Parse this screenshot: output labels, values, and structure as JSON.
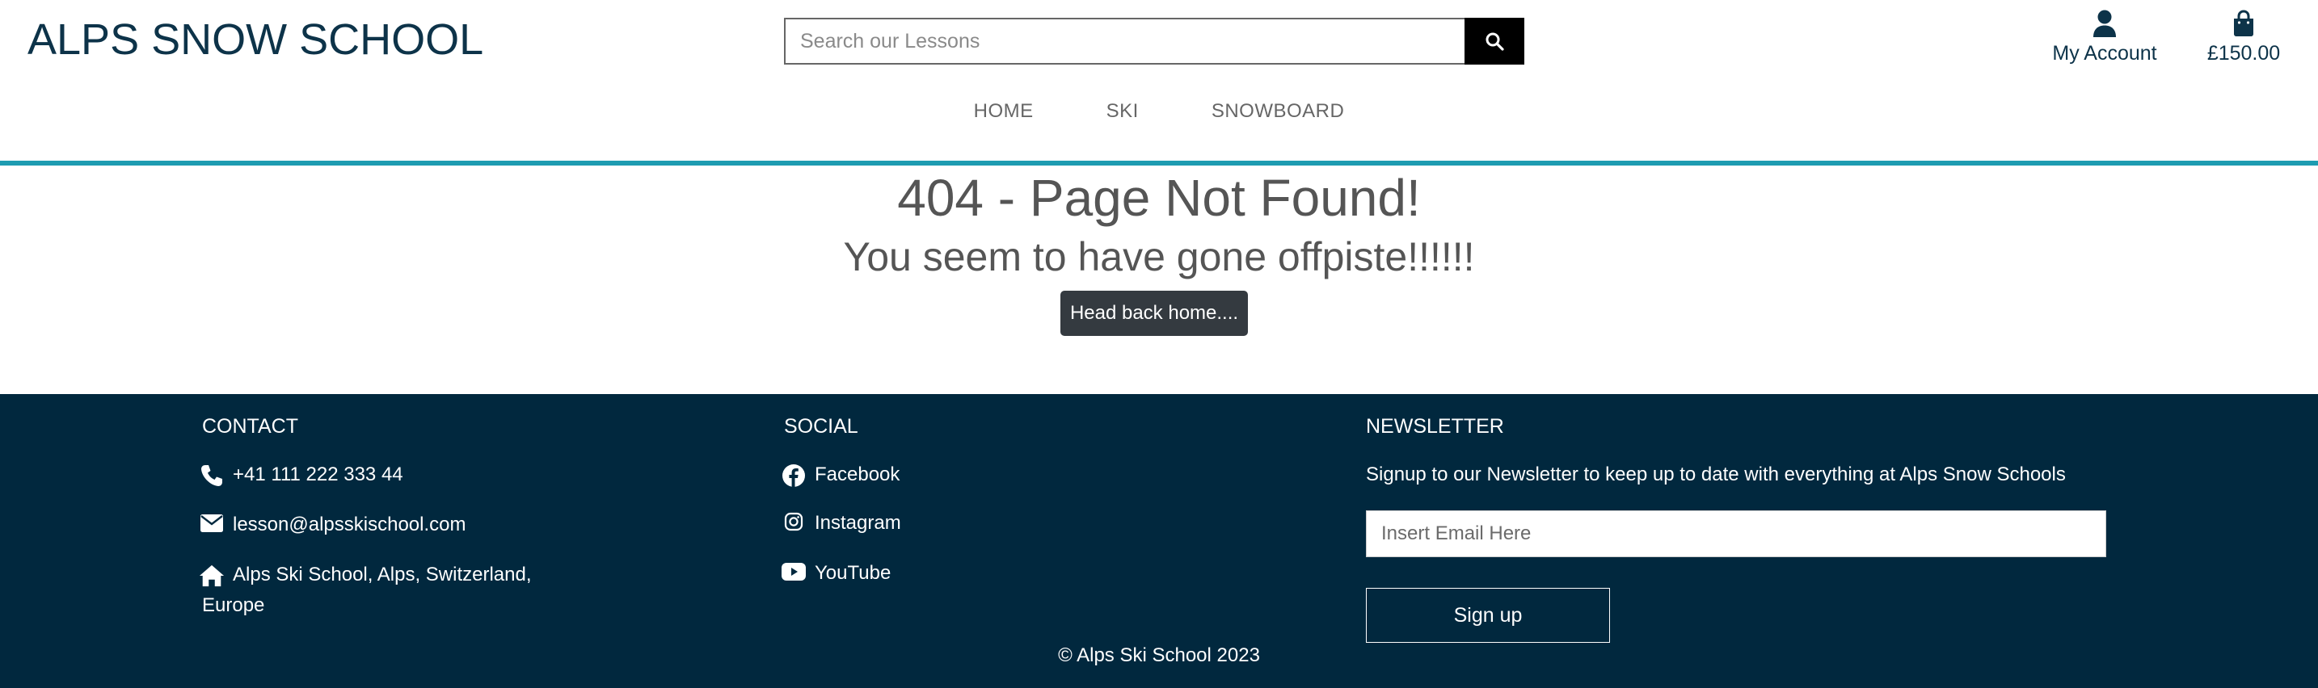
{
  "header": {
    "brand": "ALPS SNOW SCHOOL",
    "search_placeholder": "Search our Lessons",
    "account_label": "My Account",
    "bag_total": "£150.00",
    "nav": [
      "HOME",
      "SKI",
      "SNOWBOARD"
    ]
  },
  "main": {
    "title": "404 - Page Not Found!",
    "subtitle": "You seem to have gone offpiste!!!!!!",
    "home_button": "Head back home...."
  },
  "footer": {
    "contact": {
      "title": "CONTACT",
      "phone": "+41 111 222 333 44",
      "email": "lesson@alpsskischool.com",
      "address_line1": "Alps Ski School, Alps, Switzerland,",
      "address_line2": "Europe"
    },
    "social": {
      "title": "SOCIAL",
      "links": [
        "Facebook",
        "Instagram",
        "YouTube"
      ]
    },
    "newsletter": {
      "title": "NEWSLETTER",
      "text": "Signup to our Newsletter to keep up to date with everything at Alps Snow Schools",
      "email_placeholder": "Insert Email Here",
      "button": "Sign up"
    },
    "copyright": "© Alps Ski School 2023"
  },
  "colors": {
    "brand": "#0d3349",
    "accent_rule": "#1e9cb1",
    "footer_bg": "#01283e",
    "button_dark": "#343a40"
  },
  "icons": [
    "search-icon",
    "user-icon",
    "shopping-bag-icon",
    "phone-icon",
    "envelope-icon",
    "home-icon",
    "facebook-icon",
    "instagram-icon",
    "youtube-icon"
  ]
}
